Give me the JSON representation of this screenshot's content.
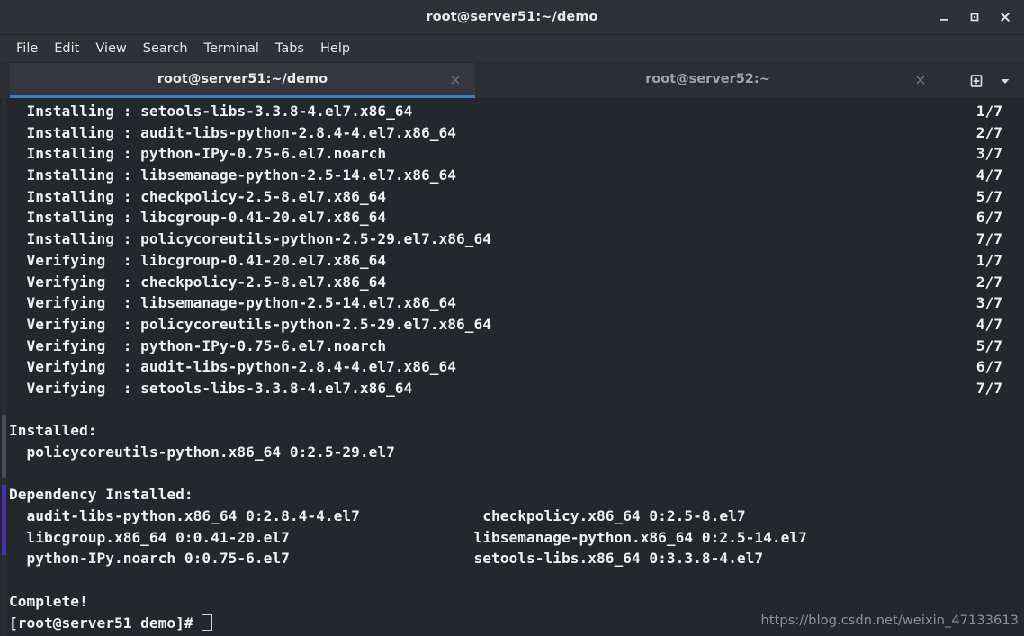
{
  "window": {
    "title": "root@server51:~/demo",
    "controls": [
      {
        "name": "minimize-button",
        "glyph": "minimize"
      },
      {
        "name": "maximize-button",
        "glyph": "maximize"
      },
      {
        "name": "close-button",
        "glyph": "close"
      }
    ]
  },
  "menubar": {
    "items": [
      "File",
      "Edit",
      "View",
      "Search",
      "Terminal",
      "Tabs",
      "Help"
    ]
  },
  "tabs": {
    "items": [
      {
        "label": "root@server51:~/demo",
        "active": true,
        "close_glyph": "×"
      },
      {
        "label": "root@server52:~",
        "active": false,
        "close_glyph": "×"
      }
    ],
    "new_tab_icon": "new-tab-icon",
    "tab_list_icon": "chevron-down-icon",
    "active_underline_color": "#3a7fc4"
  },
  "terminal": {
    "background_color": "#24272b",
    "foreground_color": "#f0f1f2",
    "prompt": "[root@server51 demo]# ",
    "lines": [
      {
        "text": "  Installing : setools-libs-3.3.8-4.el7.x86_64",
        "right": "1/7"
      },
      {
        "text": "  Installing : audit-libs-python-2.8.4-4.el7.x86_64",
        "right": "2/7"
      },
      {
        "text": "  Installing : python-IPy-0.75-6.el7.noarch",
        "right": "3/7"
      },
      {
        "text": "  Installing : libsemanage-python-2.5-14.el7.x86_64",
        "right": "4/7"
      },
      {
        "text": "  Installing : checkpolicy-2.5-8.el7.x86_64",
        "right": "5/7"
      },
      {
        "text": "  Installing : libcgroup-0.41-20.el7.x86_64",
        "right": "6/7"
      },
      {
        "text": "  Installing : policycoreutils-python-2.5-29.el7.x86_64",
        "right": "7/7"
      },
      {
        "text": "  Verifying  : libcgroup-0.41-20.el7.x86_64",
        "right": "1/7"
      },
      {
        "text": "  Verifying  : checkpolicy-2.5-8.el7.x86_64",
        "right": "2/7"
      },
      {
        "text": "  Verifying  : libsemanage-python-2.5-14.el7.x86_64",
        "right": "3/7"
      },
      {
        "text": "  Verifying  : policycoreutils-python-2.5-29.el7.x86_64",
        "right": "4/7"
      },
      {
        "text": "  Verifying  : python-IPy-0.75-6.el7.noarch",
        "right": "5/7"
      },
      {
        "text": "  Verifying  : audit-libs-python-2.8.4-4.el7.x86_64",
        "right": "6/7"
      },
      {
        "text": "  Verifying  : setools-libs-3.3.8-4.el7.x86_64",
        "right": "7/7"
      },
      {
        "text": "",
        "right": ""
      },
      {
        "text": "Installed:",
        "right": ""
      },
      {
        "text": "  policycoreutils-python.x86_64 0:2.5-29.el7",
        "right": ""
      },
      {
        "text": "",
        "right": ""
      },
      {
        "text": "Dependency Installed:",
        "right": ""
      },
      {
        "text": "  audit-libs-python.x86_64 0:2.8.4-4.el7              checkpolicy.x86_64 0:2.5-8.el7",
        "right": ""
      },
      {
        "text": "  libcgroup.x86_64 0:0.41-20.el7                     libsemanage-python.x86_64 0:2.5-14.el7",
        "right": ""
      },
      {
        "text": "  python-IPy.noarch 0:0.75-6.el7                     setools-libs.x86_64 0:3.3.8-4.el7",
        "right": ""
      },
      {
        "text": "",
        "right": ""
      },
      {
        "text": "Complete!",
        "right": ""
      }
    ]
  },
  "watermark": {
    "text": "https://blog.csdn.net/weixin_47133613"
  }
}
